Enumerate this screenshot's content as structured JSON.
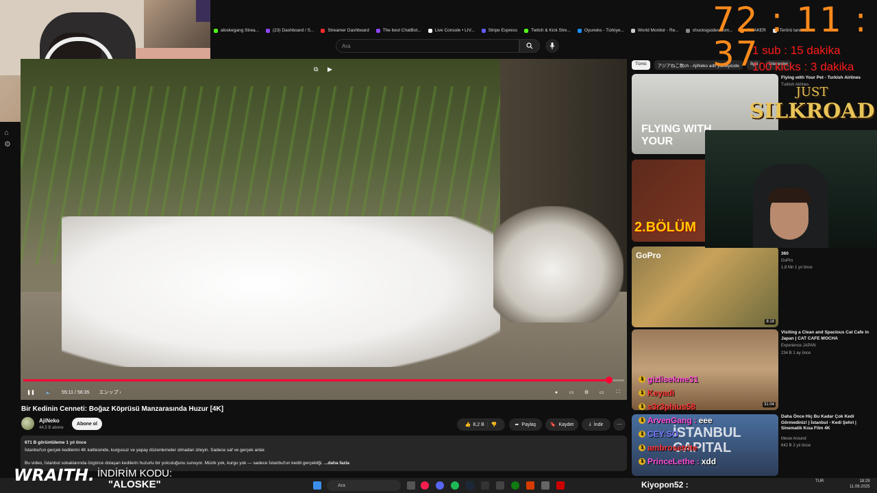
{
  "overlay": {
    "timer": "72 : 11 : 37",
    "sub_rate": "1 sub : 15 dakika",
    "kick_rate": "100 kicks : 3 dakika",
    "game_logo_line1": "JUST",
    "game_logo_line2": "SILKROAD",
    "sponsor": "WRAITH.",
    "promo_line1": "İNDİRİM KODU:",
    "promo_line2": "\"ALOSKE\"",
    "chat": [
      {
        "user": "gizlisekme31",
        "text": "",
        "color": "#ff4fd8"
      },
      {
        "user": "Keyadi",
        "text": "",
        "color": "#ff3333"
      },
      {
        "user": "s3r3phius58",
        "text": "",
        "color": "#ff3333"
      },
      {
        "user": "ArvenGang",
        "text": "eee",
        "color": "#ff4fd8"
      },
      {
        "user": "CEY:SO",
        "text": "",
        "color": "#7a7aff"
      },
      {
        "user": "ambrosetrite",
        "text": "",
        "color": "#ff3333"
      },
      {
        "user": "PrinceLethe",
        "text": "xdd",
        "color": "#ff4fd8"
      }
    ],
    "chat_bottom_user": "Kiyopon52 :"
  },
  "browser": {
    "bookmarks": [
      {
        "label": "aloskegang Strea...",
        "color": "#53fc18"
      },
      {
        "label": "(23) Dashboard / S...",
        "color": "#9146ff"
      },
      {
        "label": "Streamer Dashboard",
        "color": "#ff2a2a"
      },
      {
        "label": "The best ChatBot...",
        "color": "#9146ff"
      },
      {
        "label": "Live Console • LIV...",
        "color": "#ffffff"
      },
      {
        "label": "Stripe Express",
        "color": "#635bff"
      },
      {
        "label": "Twitch & Kick Stre...",
        "color": "#53fc18"
      },
      {
        "label": "Oyuneks - Türkiye...",
        "color": "#1e90ff"
      },
      {
        "label": "World Monitor - Re...",
        "color": "#cccccc"
      },
      {
        "label": "chucksguides.com...",
        "color": "#888888"
      },
      {
        "label": "OMAKER",
        "color": "#ff8a1c"
      },
      {
        "label": "Terörü tanıma,...",
        "color": "#e0e0e0"
      }
    ]
  },
  "youtube": {
    "search_placeholder": "Ara",
    "video": {
      "title": "Bir Kedinin Cenneti: Boğaz Köprüsü Manzarasında Huzur [4K]",
      "time_current": "55:11",
      "time_total": "56:35",
      "chapter": "エンップ",
      "progress": 0.975
    },
    "channel": {
      "name": "AjiNeko",
      "subs": "44,5 B abone",
      "subscribe_label": "Abone ol"
    },
    "actions": {
      "likes": "8,2 B",
      "share": "Paylaş",
      "save": "Kaydet",
      "download": "İndir"
    },
    "description": {
      "stats": "671 B görüntüleme  1 yıl önce",
      "line1": "İstanbul'un gerçek kedilerini 4K kalitesinde, kurgusuz ve yapay düzenlemeler olmadan izleyin. Sadece saf ve gerçek anlar.",
      "line2": "Bu video, İstanbul sokaklarında özgürce dolaşan kedilerin huzurlu bir yolculuğunu sunuyor. Müzik yok, kurgu yok — sadece İstanbul'un kedili gerçekliği.",
      "more": "...daha fazla"
    },
    "chips": [
      "Tümü",
      "アジアねこ歌ch - AjiNeko adlı yükleyicide",
      "İlgili",
      "İzlenenler"
    ],
    "recommended": [
      {
        "title": "Flying with Your Pet - Turkish Airlines",
        "channel": "Turkish Airlines",
        "meta": "",
        "duration": "",
        "thumb_text": "FLYING WITH YOUR"
      },
      {
        "title": "",
        "channel": "",
        "meta": "",
        "duration": "",
        "thumb_text": "2.BÖLÜM"
      },
      {
        "title": "360",
        "channel": "GoPro",
        "meta": "1,8 Mn  1 yıl önce",
        "duration": "8:18",
        "thumb_text": "GoPro"
      },
      {
        "title": "Visiting a Clean and Spacious Cat Cafe in Japan | CAT CAFE MOCHA",
        "channel": "Experience JAPAN",
        "meta": "234 B  1 ay önce",
        "duration": "31:04",
        "thumb_text": ""
      },
      {
        "title": "Daha Önce Hiç Bu Kadar Çok Kedi Görmediniz! | İstanbul - Kedi Şehri | Sinematik Kısa Film 4K",
        "channel": "Meow Around",
        "meta": "642 B  2 yıl önce",
        "duration": "",
        "thumb_text": "İSTANBUL CAPITAL"
      }
    ]
  },
  "taskbar": {
    "search_label": "Ara",
    "tray_lang": "TUR",
    "time": "18:29",
    "date": "11.08.2025"
  }
}
